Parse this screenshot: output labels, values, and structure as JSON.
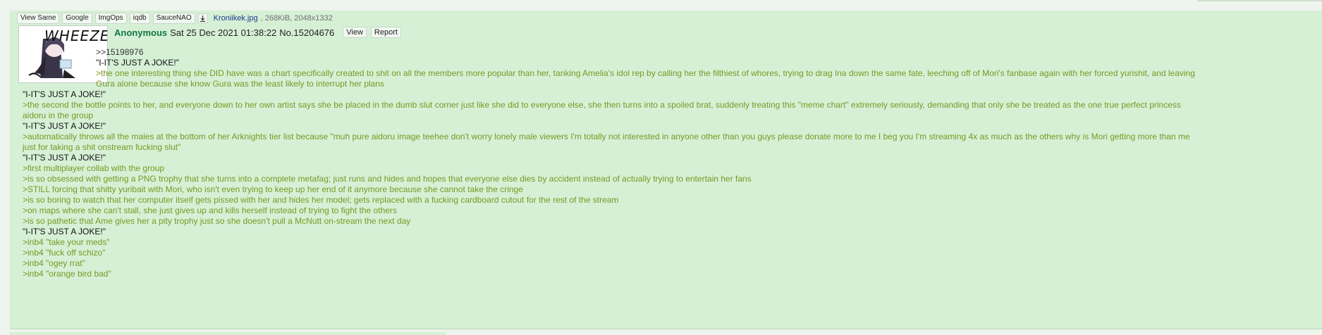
{
  "file_bar": {
    "buttons": [
      "View Same",
      "Google",
      "ImgOps",
      "iqdb",
      "SauceNAO"
    ],
    "download_icon": "download-icon",
    "filename": "Kroniikek.jpg",
    "fileinfo": ", 268KiB, 2048x1332"
  },
  "thumb": {
    "caption": "WHEEZE"
  },
  "header": {
    "name": "Anonymous",
    "date": "Sat 25 Dec 2021 01:38:22",
    "postno": "No.15204676",
    "view_label": "View",
    "report_label": "Report"
  },
  "lines": [
    {
      "text": ">>15198976",
      "kind": "reply"
    },
    {
      "text": "\"I-IT'S JUST A JOKE!\"",
      "kind": "plain"
    },
    {
      "text": ">the one interesting thing she DID have was a chart specifically created to shit on all the members more popular than her, tanking Amelia's idol rep by calling her the filthiest of whores, trying to drag Ina down the same fate, leeching off of Mori's fanbase again with her forced yurishit, and leaving",
      "kind": "quote"
    },
    {
      "text": "Gura alone because she know Gura was the least likely to interrupt her plans",
      "kind": "quote"
    },
    {
      "text": "\"I-IT'S JUST A JOKE!\"",
      "kind": "plain"
    },
    {
      "text": ">the second the bottle points to her, and everyone down to her own artist says she be placed in the dumb slut corner just like she did to everyone else, she then turns into a spoiled brat, suddenly treating this \"meme chart\" extremely seriously, demanding that only she be treated as the one true perfect princess",
      "kind": "quote"
    },
    {
      "text": "aidoru in the group",
      "kind": "quote"
    },
    {
      "text": "\"I-IT'S JUST A JOKE!\"",
      "kind": "plain"
    },
    {
      "text": ">automatically throws all the males at the bottom of her Arknights tier list because \"muh pure aidoru image teehee don't worry lonely male viewers I'm totally not interested in anyone other than you guys please donate more to me I beg you I'm streaming 4x as much as the others why is Mori getting more than me",
      "kind": "quote"
    },
    {
      "text": "just for taking a shit onstream fucking slut\"",
      "kind": "quote"
    },
    {
      "text": "\"I-IT'S JUST A JOKE!\"",
      "kind": "plain"
    },
    {
      "text": ">first multiplayer collab with the group",
      "kind": "quote"
    },
    {
      "text": ">is so obsessed with getting a PNG trophy that she turns into a complete metafag; just runs and hides and hopes that everyone else dies by accident instead of actually trying to entertain her fans",
      "kind": "quote"
    },
    {
      "text": ">STILL forcing that shitty yuribait with Mori, who isn't even trying to keep up her end of it anymore because she cannot take the cringe",
      "kind": "quote"
    },
    {
      "text": ">is so boring to watch that her computer itself gets pissed with her and hides her model; gets replaced with a fucking cardboard cutout for the rest of the stream",
      "kind": "quote"
    },
    {
      "text": ">on maps where she can't stall, she just gives up and kills herself instead of trying to fight the others",
      "kind": "quote"
    },
    {
      "text": ">is so pathetic that Ame gives her a pity trophy just so she doesn't pull a McNutt on-stream the next day",
      "kind": "quote"
    },
    {
      "text": "\"I-IT'S JUST A JOKE!\"",
      "kind": "plain"
    },
    {
      "text": ">inb4 \"take your meds\"",
      "kind": "quote"
    },
    {
      "text": ">inb4 \"fuck off schizo\"",
      "kind": "quote"
    },
    {
      "text": ">inb4 \"ogey rrat\"",
      "kind": "quote"
    },
    {
      "text": ">inb4 \"orange bird bad\"",
      "kind": "quote"
    }
  ],
  "colors": {
    "post_bg": "#d6f0d6",
    "quote": "#789922",
    "name": "#117743",
    "filename": "#1a3a8a"
  }
}
